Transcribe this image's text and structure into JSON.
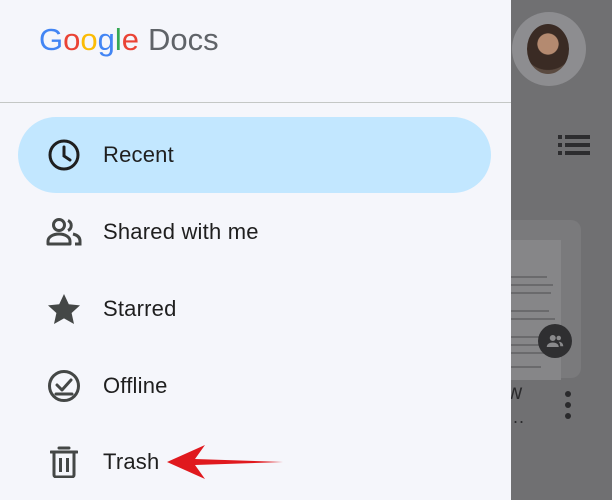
{
  "app": {
    "logo_google": [
      "G",
      "o",
      "o",
      "g",
      "l",
      "e"
    ],
    "logo_product": "Docs"
  },
  "drawer": {
    "items": [
      {
        "label": "Recent",
        "icon": "clock-icon",
        "active": true
      },
      {
        "label": "Shared with me",
        "icon": "people-icon",
        "active": false
      },
      {
        "label": "Starred",
        "icon": "star-icon",
        "active": false
      },
      {
        "label": "Offline",
        "icon": "offline-check-icon",
        "active": false
      },
      {
        "label": "Trash",
        "icon": "trash-icon",
        "active": false
      }
    ]
  },
  "background": {
    "doc_title_fragment": "w",
    "doc_title_ellipsis": "..."
  },
  "colors": {
    "active_bg": "#c2e7ff",
    "drawer_bg": "#f5f6fb",
    "arrow": "#e0191e"
  }
}
